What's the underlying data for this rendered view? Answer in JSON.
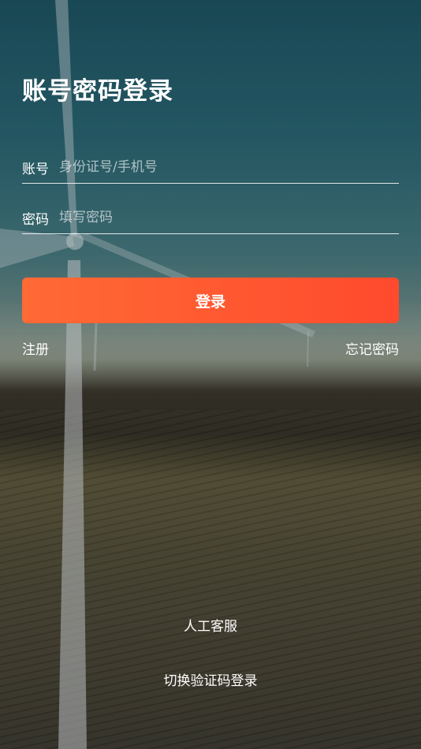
{
  "page": {
    "title": "账号密码登录"
  },
  "form": {
    "account_label": "账号",
    "account_placeholder": "身份证号/手机号",
    "password_label": "密码",
    "password_placeholder": "填写密码"
  },
  "actions": {
    "login_label": "登录",
    "register_label": "注册",
    "forgot_label": "忘记密码",
    "support_label": "人工客服",
    "switch_label": "切换验证码登录"
  },
  "colors": {
    "accent_start": "#ff6a35",
    "accent_end": "#ff4a2d"
  }
}
